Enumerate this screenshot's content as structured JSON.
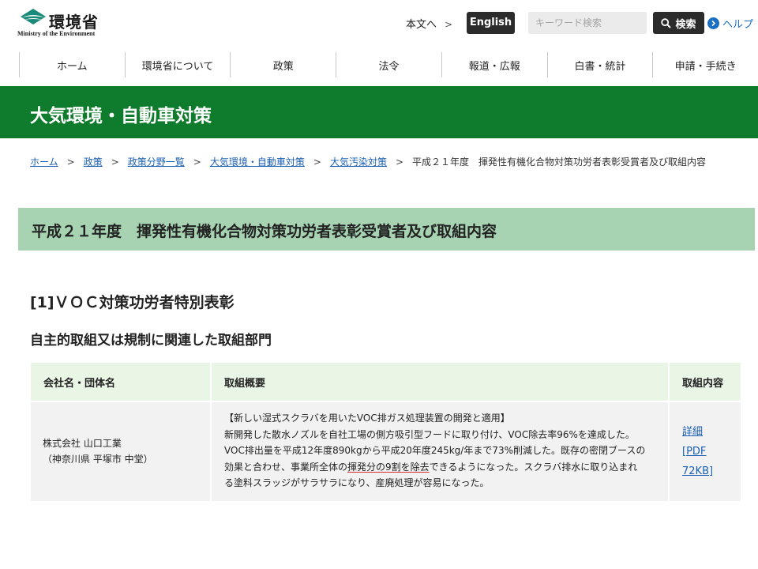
{
  "header": {
    "logo_title": "環境省",
    "logo_subtitle": "Ministry of the Environment",
    "skip_link": "本文へ",
    "english_label": "English",
    "search_placeholder": "キーワード検索",
    "search_button": "検索",
    "help_label": "ヘルプ"
  },
  "nav": {
    "items": [
      "ホーム",
      "環境省について",
      "政策",
      "法令",
      "報道・広報",
      "白書・統計",
      "申請・手続き"
    ]
  },
  "banner": {
    "title": "大気環境・自動車対策"
  },
  "breadcrumb": {
    "links": [
      "ホーム",
      "政策",
      "政策分野一覧",
      "大気環境・自動車対策",
      "大気汚染対策"
    ],
    "separator": ">",
    "current": "平成２１年度　揮発性有機化合物対策功労者表彰受賞者及び取組内容"
  },
  "page": {
    "title": "平成２１年度　揮発性有機化合物対策功労者表彰受賞者及び取組内容",
    "section_heading": "[1]ＶＯＣ対策功労者特別表彰",
    "subsection_heading": "自主的取組又は規制に関連した取組部門"
  },
  "table": {
    "headers": [
      "会社名・団体名",
      "取組概要",
      "取組内容"
    ],
    "rows": [
      {
        "org_name": "株式会社 山口工業",
        "org_location": "（神奈川県 平塚市 中堂）",
        "summary_title": "【新しい湿式スクラバを用いたVOC排ガス処理装置の開発と適用】",
        "summary_line1": "新開発した散水ノズルを自社工場の側方吸引型フードに取り付け、VOC除去率96%を達成した。",
        "summary_line2": "VOC排出量を平成12年度890kgから平成20年度245kg/年まで73%削減した。既存の密閉ブースの",
        "summary_line3_before": "効果と合わせ、事業所全体の",
        "summary_line3_highlight": "揮発分の9割を除去",
        "summary_line3_after": "できるようになった。スクラバ排水に取り込まれ",
        "summary_line4": "る塗料スラッジがサラサラになり、産廃処理が容易になった。",
        "link_detail": "詳細",
        "link_pdf_1": "[PDF",
        "link_pdf_2": "72KB]"
      }
    ]
  },
  "colors": {
    "banner_green": "#0f7b2c",
    "title_box_green": "#a7d3b2",
    "table_header_bg": "#e9f6e6",
    "link_blue": "#1a5fb4"
  }
}
